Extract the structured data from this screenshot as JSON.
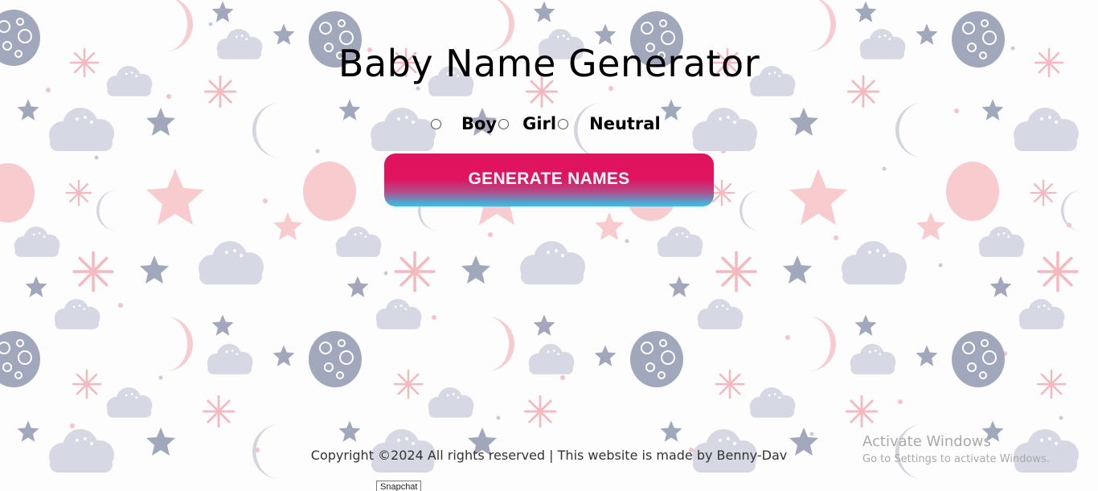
{
  "page": {
    "title": "Baby Name Generator"
  },
  "gender_options": [
    {
      "label": "Boy",
      "selected": false
    },
    {
      "label": "Girl",
      "selected": false
    },
    {
      "label": "Neutral",
      "selected": false
    }
  ],
  "generate_button": {
    "label": "GENERATE NAMES",
    "gradient_colors": [
      "#e0145e",
      "#2dc8ec"
    ]
  },
  "footer": {
    "copyright": "Copyright ©2024 All rights reserved | This website is made by Benny-Dav",
    "snapchat_label": "Snapchat"
  },
  "os_watermark": {
    "title": "Activate Windows",
    "subtitle": "Go to Settings to activate Windows."
  },
  "background": {
    "pattern_icons": [
      "moon-icon",
      "cloud-icon",
      "star-icon",
      "sparkle-icon",
      "planet-icon",
      "egg-icon"
    ],
    "colors": {
      "pink": "#f8cccf",
      "slate": "#a2a8bb",
      "cloud": "#d6d9e3",
      "page": "#fdfdfe"
    }
  }
}
